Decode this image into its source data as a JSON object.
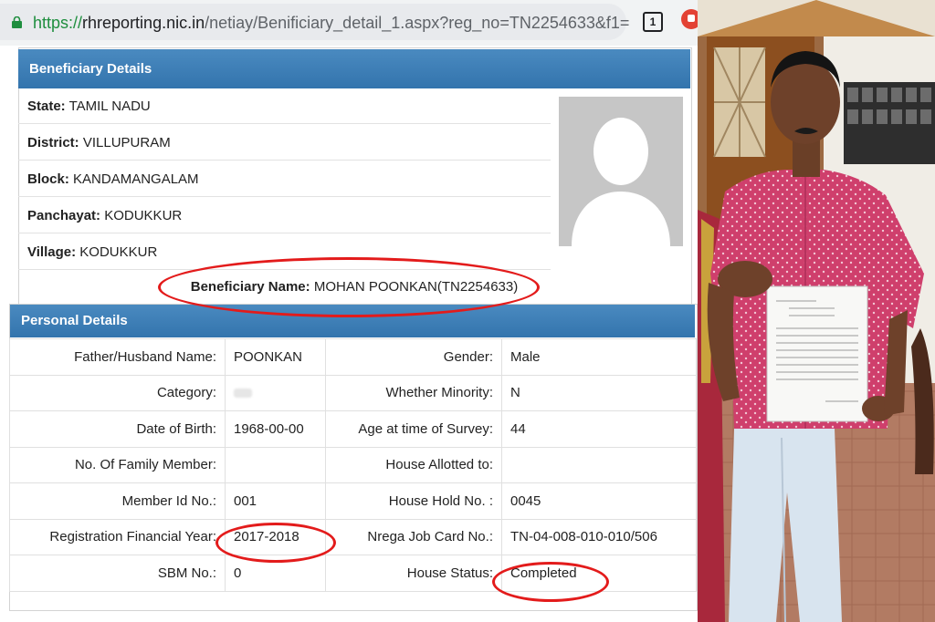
{
  "browser": {
    "url_scheme": "https://",
    "url_host": "rhreporting.nic.in",
    "url_path": "/netiay/Benificiary_detail_1.aspx?reg_no=TN2254633&f1=",
    "tab_count": "1"
  },
  "beneficiary_details": {
    "title": "Beneficiary Details",
    "rows": [
      {
        "label": "State:",
        "value": "TAMIL NADU"
      },
      {
        "label": "District:",
        "value": "VILLUPURAM"
      },
      {
        "label": "Block:",
        "value": "KANDAMANGALAM"
      },
      {
        "label": "Panchayat:",
        "value": "KODUKKUR"
      },
      {
        "label": "Village:",
        "value": "KODUKKUR"
      }
    ],
    "beneficiary_name_label": "Beneficiary Name:",
    "beneficiary_name_value": "MOHAN POONKAN(TN2254633)"
  },
  "personal_details": {
    "title": "Personal Details",
    "rows": [
      {
        "l1": "Father/Husband Name:",
        "v1": "POONKAN",
        "l2": "Gender:",
        "v2": "Male"
      },
      {
        "l1": "Category:",
        "v1": "",
        "l2": "Whether Minority:",
        "v2": "N"
      },
      {
        "l1": "Date of Birth:",
        "v1": "1968-00-00",
        "l2": "Age at time of Survey:",
        "v2": "44"
      },
      {
        "l1": "No. Of Family Member:",
        "v1": "",
        "l2": "House Allotted to:",
        "v2": ""
      },
      {
        "l1": "Member Id No.:",
        "v1": "001",
        "l2": "House Hold No. :",
        "v2": "0045"
      },
      {
        "l1": "Registration Financial Year:",
        "v1": "2017-2018",
        "l2": "Nrega Job Card No.:",
        "v2": "TN-04-008-010-010/506"
      },
      {
        "l1": "SBM No.:",
        "v1": "0",
        "l2": "House Status:",
        "v2": "Completed"
      }
    ]
  },
  "colors": {
    "header_blue": "#3374ad",
    "highlight_red": "#e31b1b",
    "url_green": "#1e8e3e"
  }
}
